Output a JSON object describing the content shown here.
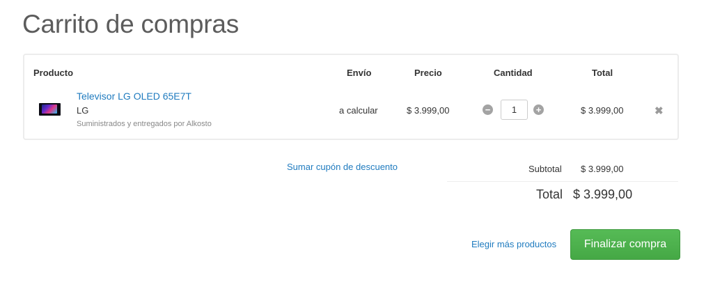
{
  "page": {
    "title": "Carrito de compras"
  },
  "table": {
    "headers": {
      "product": "Producto",
      "shipping": "Envío",
      "price": "Precio",
      "quantity": "Cantidad",
      "total": "Total"
    },
    "items": [
      {
        "name": "Televisor LG OLED 65E7T",
        "brand": "LG",
        "supplier": "Suministrados y entregados por Alkosto",
        "shipping": "a calcular",
        "price": "$ 3.999,00",
        "quantity": "1",
        "total": "$ 3.999,00",
        "image_icon": "tv-thumbnail"
      }
    ]
  },
  "summary": {
    "coupon_link": "Sumar cupón de descuento",
    "subtotal_label": "Subtotal",
    "subtotal_value": "$ 3.999,00",
    "total_label": "Total",
    "total_value": "$ 3.999,00"
  },
  "actions": {
    "more_products": "Elegir más productos",
    "checkout": "Finalizar compra"
  },
  "colors": {
    "link": "#1f7bbf",
    "checkout_button": "#4cae4c",
    "title": "#5c5c5c"
  }
}
